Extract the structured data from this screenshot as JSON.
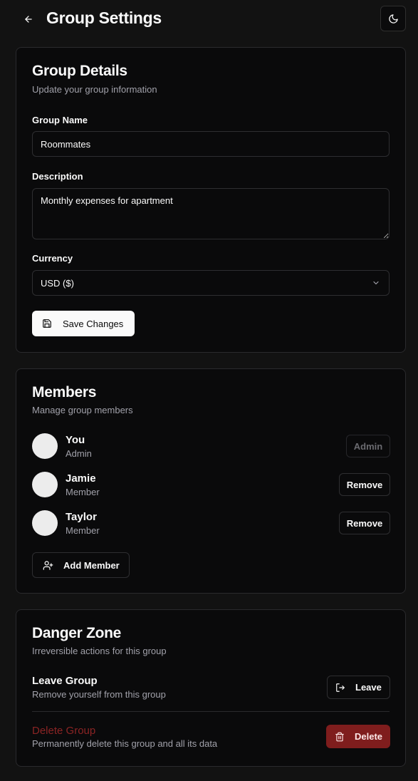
{
  "header": {
    "title": "Group Settings",
    "back_icon": "arrow-left-icon",
    "theme_icon": "moon-icon"
  },
  "details": {
    "title": "Group Details",
    "subtitle": "Update your group information",
    "name_label": "Group Name",
    "name_value": "Roommates",
    "description_label": "Description",
    "description_value": "Monthly expenses for apartment",
    "currency_label": "Currency",
    "currency_value": "USD ($)",
    "save_label": "Save Changes"
  },
  "members": {
    "title": "Members",
    "subtitle": "Manage group members",
    "list": [
      {
        "name": "You",
        "role": "Admin",
        "action": "Admin"
      },
      {
        "name": "Jamie",
        "role": "Member",
        "action": "Remove"
      },
      {
        "name": "Taylor",
        "role": "Member",
        "action": "Remove"
      }
    ],
    "add_label": "Add Member"
  },
  "danger": {
    "title": "Danger Zone",
    "subtitle": "Irreversible actions for this group",
    "leave_title": "Leave Group",
    "leave_desc": "Remove yourself from this group",
    "leave_label": "Leave",
    "delete_title": "Delete Group",
    "delete_desc": "Permanently delete this group and all its data",
    "delete_label": "Delete"
  },
  "colors": {
    "background": "#121212",
    "card": "#0a0a0b",
    "danger": "#7f1d1d",
    "danger_text": "#8b2424"
  }
}
